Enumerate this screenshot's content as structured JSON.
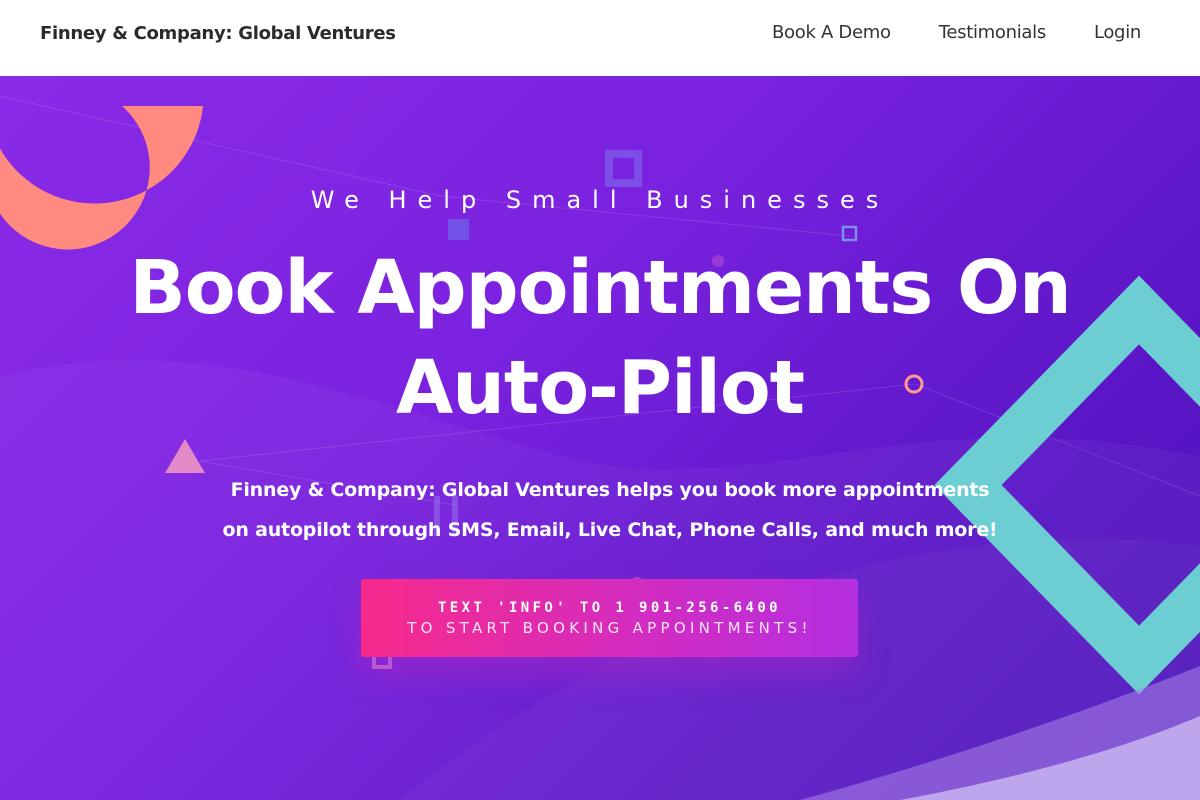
{
  "brand": "Finney & Company: Global Ventures",
  "nav": {
    "book_demo": "Book A Demo",
    "testimonials": "Testimonials",
    "login": "Login"
  },
  "hero": {
    "eyebrow": "We Help Small Businesses",
    "headline": "Book Appointments On Auto-Pilot",
    "subtext": "Finney & Company: Global Ventures helps you book more appointments on autopilot through SMS, Email, Live Chat, Phone Calls, and much more!",
    "cta_line1": "TEXT 'INFO' TO 1 901-256-6400",
    "cta_line2": "TO START BOOKING APPOINTMENTS!"
  },
  "colors": {
    "hero_gradient_start": "#8a2be6",
    "hero_gradient_end": "#4a12b8",
    "cta_start": "#f72a8a",
    "cta_end": "#b42fe0",
    "coral_ring": "#ff8a80",
    "teal_diamond": "#6ccdd3"
  }
}
